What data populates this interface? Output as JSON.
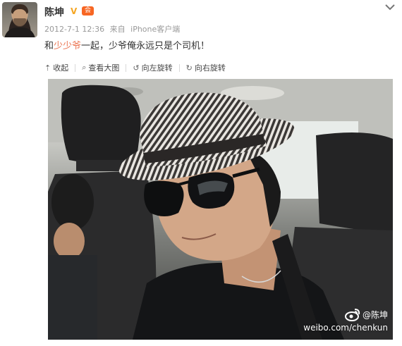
{
  "post": {
    "author": "陈坤",
    "verified_mark": "V",
    "member_badge": "会",
    "timestamp": "2012-7-1 12:36",
    "source_prefix": "来自",
    "source": "iPhone客户端",
    "text_prefix": "和",
    "mention": "少少爷",
    "text_suffix": "一起，少爷俺永远只是个司机！"
  },
  "actions": {
    "collapse": "收起",
    "view_large": "查看大图",
    "rotate_left": "向左旋转",
    "rotate_right": "向右旋转"
  },
  "watermark": {
    "handle": "@陈坤",
    "url": "weibo.com/chenkun"
  },
  "colors": {
    "mention": "#eb7350",
    "meta_gray": "#999999",
    "verified": "#f5a623",
    "member_badge": "#f76623"
  }
}
